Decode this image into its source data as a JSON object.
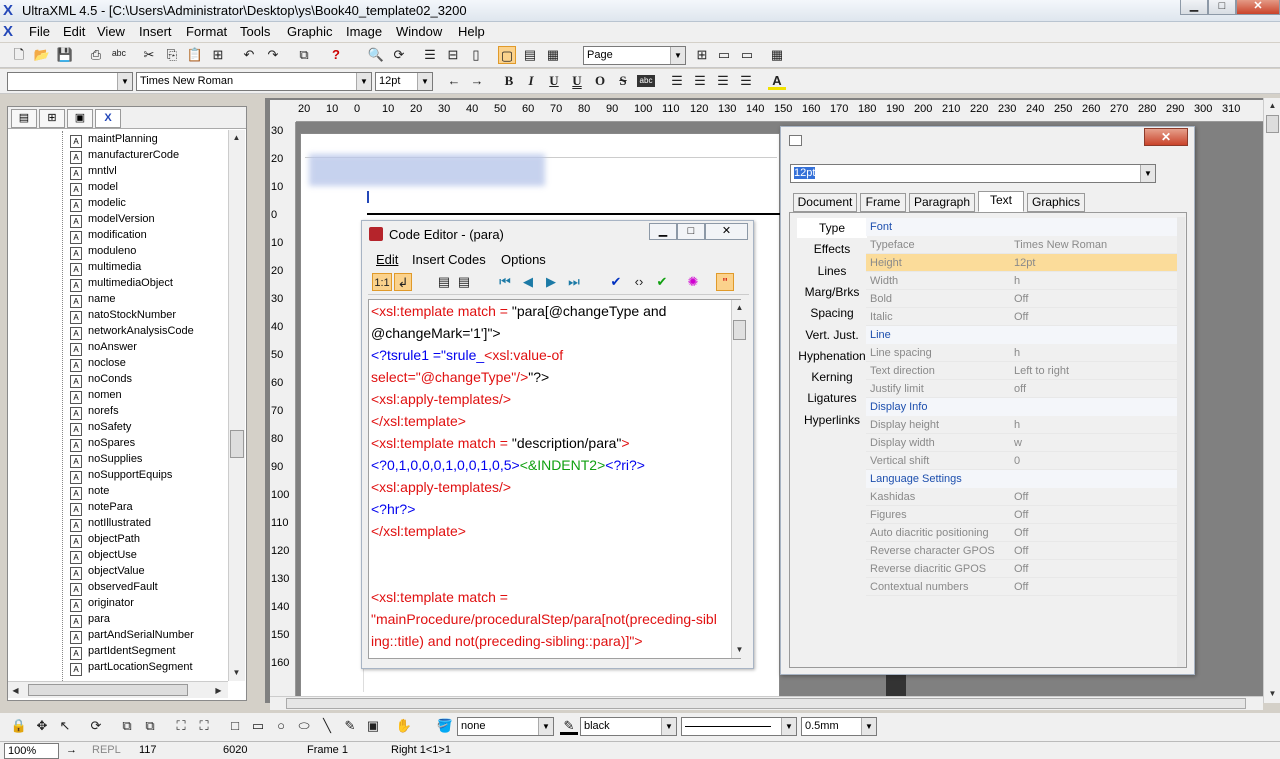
{
  "app": {
    "title": "UltraXML 4.5 - [C:\\Users\\Administrator\\Desktop\\ys\\Book40_template02_3200"
  },
  "menu": [
    "File",
    "Edit",
    "View",
    "Insert",
    "Format",
    "Tools",
    "Graphic",
    "Image",
    "Window",
    "Help"
  ],
  "toolbar2": {
    "view_combo": "Page"
  },
  "format_bar": {
    "style": "",
    "font": "Times New Roman",
    "size": "12pt"
  },
  "tree": {
    "items": [
      "maintPlanning",
      "manufacturerCode",
      "mntlvl",
      "model",
      "modelic",
      "modelVersion",
      "modification",
      "moduleno",
      "multimedia",
      "multimediaObject",
      "name",
      "natoStockNumber",
      "networkAnalysisCode",
      "noAnswer",
      "noclose",
      "noConds",
      "nomen",
      "norefs",
      "noSafety",
      "noSpares",
      "noSupplies",
      "noSupportEquips",
      "note",
      "notePara",
      "notIllustrated",
      "objectPath",
      "objectUse",
      "objectValue",
      "observedFault",
      "originator",
      "para",
      "partAndSerialNumber",
      "partIdentSegment",
      "partLocationSegment"
    ]
  },
  "ruler": {
    "h": [
      "20",
      "10",
      "0",
      "10",
      "20",
      "30",
      "40",
      "50",
      "60",
      "70",
      "80",
      "90",
      "100",
      "110",
      "120",
      "130",
      "140",
      "150",
      "160",
      "170",
      "180",
      "190",
      "200",
      "210",
      "220",
      "230",
      "240",
      "250",
      "260",
      "270",
      "280",
      "290",
      "300",
      "310"
    ],
    "v": [
      "30",
      "20",
      "10",
      "0",
      "10",
      "20",
      "30",
      "40",
      "50",
      "60",
      "70",
      "80",
      "90",
      "100",
      "110",
      "120",
      "130",
      "140",
      "150",
      "160"
    ]
  },
  "code_editor": {
    "title": "Code Editor - (para)",
    "menu": [
      "Edit",
      "Insert Codes",
      "Options"
    ],
    "lines": [
      [
        {
          "t": "<xsl:template match = ",
          "c": "red"
        },
        {
          "t": "\"para[@changeType and",
          "c": "blk"
        }
      ],
      [
        {
          "t": "@changeMark='1']\">",
          "c": "blk"
        }
      ],
      [
        {
          "t": "<?tsrule1 =\"srule_",
          "c": "blue"
        },
        {
          "t": "<xsl:value-of",
          "c": "red"
        }
      ],
      [
        {
          "t": "select=\"@changeType\"/>",
          "c": "red"
        },
        {
          "t": "\"?>",
          "c": "blk"
        }
      ],
      [
        {
          "t": "<xsl:apply-templates/>",
          "c": "red"
        }
      ],
      [
        {
          "t": "</xsl:template>",
          "c": "red"
        }
      ],
      [
        {
          "t": "<xsl:template match = ",
          "c": "red"
        },
        {
          "t": "\"description/para\"",
          "c": "blk"
        },
        {
          "t": ">",
          "c": "red"
        }
      ],
      [
        {
          "t": "<?0,1,0,0,0,1,0,0,1,0,5>",
          "c": "blue"
        },
        {
          "t": "<&INDENT2>",
          "c": "green"
        },
        {
          "t": "<?ri?>",
          "c": "blue"
        }
      ],
      [
        {
          "t": "<xsl:apply-templates/>",
          "c": "red"
        }
      ],
      [
        {
          "t": "<?hr?>",
          "c": "blue"
        }
      ],
      [
        {
          "t": "</xsl:template>",
          "c": "red"
        }
      ],
      [],
      [],
      [
        {
          "t": "<xsl:template match =",
          "c": "red"
        }
      ],
      [
        {
          "t": "\"mainProcedure/proceduralStep/para[not(preceding-sibl",
          "c": "red"
        }
      ],
      [
        {
          "t": "ing::title) and not(preceding-sibling::para)]\">",
          "c": "red"
        }
      ]
    ]
  },
  "props": {
    "size_value": "12pt",
    "tabs": [
      "Document",
      "Frame",
      "Paragraph",
      "Text",
      "Graphics"
    ],
    "active_tab": "Text",
    "categories": [
      "Type",
      "Effects",
      "Lines",
      "Marg/Brks",
      "Spacing",
      "Vert. Just.",
      "Hyphenation",
      "Kerning",
      "Ligatures",
      "Hyperlinks"
    ],
    "rows": [
      {
        "section": "Font"
      },
      {
        "k": "Typeface",
        "v": "Times New Roman"
      },
      {
        "k": "Height",
        "v": "12pt",
        "hl": true
      },
      {
        "k": "Width",
        "v": "h"
      },
      {
        "k": "Bold",
        "v": "Off"
      },
      {
        "k": "Italic",
        "v": "Off"
      },
      {
        "section": "Line"
      },
      {
        "k": "Line spacing",
        "v": "h"
      },
      {
        "k": "Text direction",
        "v": "Left to right"
      },
      {
        "k": "Justify limit",
        "v": "off"
      },
      {
        "section": "Display Info"
      },
      {
        "k": "Display height",
        "v": "h"
      },
      {
        "k": "Display width",
        "v": "w"
      },
      {
        "k": "Vertical shift",
        "v": "0"
      },
      {
        "section": "Language Settings"
      },
      {
        "k": "Kashidas",
        "v": "Off"
      },
      {
        "k": "Figures",
        "v": "Off"
      },
      {
        "k": "Auto diacritic positioning",
        "v": "Off"
      },
      {
        "k": "Reverse character GPOS",
        "v": "Off"
      },
      {
        "k": "Reverse diacritic GPOS",
        "v": "Off"
      },
      {
        "k": "Contextual numbers",
        "v": "Off"
      }
    ]
  },
  "bottom_bar": {
    "fill": "none",
    "line": "black",
    "line_style": "",
    "width": "0.5mm"
  },
  "status": {
    "zoom": "100%",
    "mode": "REPL",
    "line": "117",
    "pos": "6020",
    "frame": "Frame 1",
    "right": "Right 1<1>1"
  }
}
